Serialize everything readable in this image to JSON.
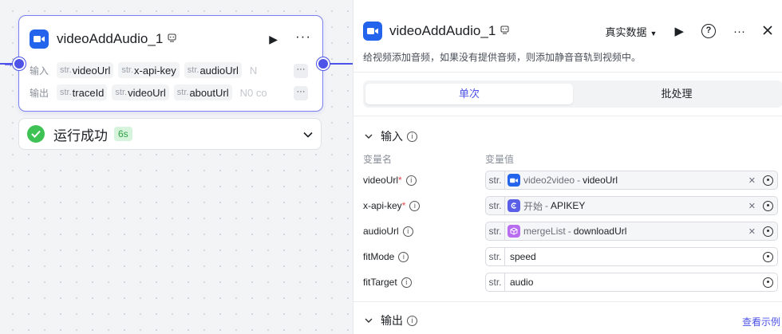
{
  "node": {
    "title": "videoAddAudio_1",
    "input_label": "输入",
    "output_label": "输出",
    "type_prefix": "str.",
    "inputs": [
      "videoUrl",
      "x-api-key",
      "audioUrl",
      "N"
    ],
    "outputs": [
      "traceId",
      "videoUrl",
      "aboutUrl",
      "N0 co"
    ],
    "more_label": "···"
  },
  "status": {
    "text": "运行成功",
    "time": "6s"
  },
  "panel": {
    "title": "videoAddAudio_1",
    "mode": "真实数据",
    "description": "给视频添加音频，如果没有提供音频，则添加静音音轨到视频中。",
    "tabs": [
      "单次",
      "批处理"
    ],
    "input_section": "输入",
    "col_name": "变量名",
    "col_value": "变量值",
    "params": [
      {
        "name": "videoUrl",
        "required": "*",
        "type": "str.",
        "ref_node": "video2video",
        "ref_var": "videoUrl",
        "icon_color": "#2463eb"
      },
      {
        "name": "x-api-key",
        "required": "*",
        "type": "str.",
        "ref_node": "开始",
        "ref_var": "APIKEY",
        "icon_color": "#5b5fe8"
      },
      {
        "name": "audioUrl",
        "required": "",
        "type": "str.",
        "ref_node": "mergeList",
        "ref_var": "downloadUrl",
        "icon_color": "#b86cf0"
      },
      {
        "name": "fitMode",
        "required": "",
        "type": "str.",
        "value": "speed"
      },
      {
        "name": "fitTarget",
        "required": "",
        "type": "str.",
        "value": "audio"
      }
    ],
    "ref_separator": "-",
    "output_section": "输出",
    "example_link": "查看示例"
  },
  "colors": {
    "accent": "#4d53e8",
    "success": "#3ec254",
    "required": "#e5484d"
  }
}
